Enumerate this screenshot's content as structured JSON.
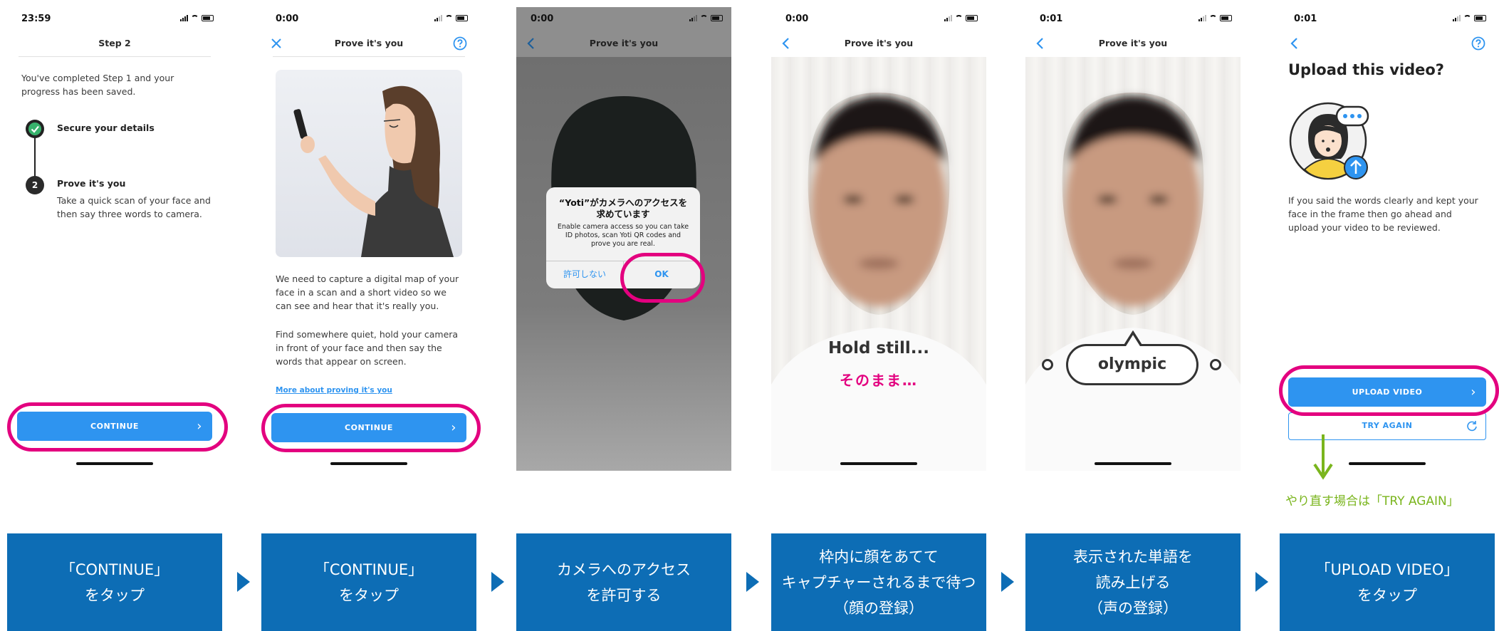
{
  "colors": {
    "accent": "#2e94f0",
    "highlight": "#e3007f",
    "caption_bg": "#0d6db5",
    "green": "#7ab51d",
    "check_green": "#37b26c"
  },
  "screens": [
    {
      "time": "23:59",
      "title": "Step 2",
      "intro": "You've completed Step 1 and your progress has been saved.",
      "step1_label": "Secure your details",
      "step2_number": "2",
      "step2_label": "Prove it's you",
      "step2_desc": "Take a quick scan of your face and then say three words to camera.",
      "button": "CONTINUE"
    },
    {
      "time": "0:00",
      "title": "Prove it's you",
      "para1": "We need to capture a digital map of your face in a scan and a short video so we can see and hear that it's really you.",
      "para2": "Find somewhere quiet, hold your camera in front of your face and then say the words that appear on screen.",
      "link": "More about proving it's you",
      "button": "CONTINUE"
    },
    {
      "time": "0:00",
      "title": "Prove it's you",
      "dialog_title": "“Yoti”がカメラへのアクセスを求めています",
      "dialog_message": "Enable camera access so you can take ID photos, scan Yoti QR codes and prove you are real.",
      "deny": "許可しない",
      "ok": "OK"
    },
    {
      "time": "0:00",
      "title": "Prove it's you",
      "hold_text": "Hold still...",
      "hold_jp": "そのまま…"
    },
    {
      "time": "0:01",
      "title": "Prove it's you",
      "word": "olympic"
    },
    {
      "time": "0:01",
      "heading": "Upload this video?",
      "desc": "If you said the words clearly and kept your face in the frame then go ahead and upload your video to be reviewed.",
      "upload_button": "UPLOAD VIDEO",
      "retry_button": "TRY AGAIN",
      "retry_note": "やり直す場合は「TRY AGAIN」"
    }
  ],
  "captions": [
    [
      "「CONTINUE」",
      "をタップ"
    ],
    [
      "「CONTINUE」",
      "をタップ"
    ],
    [
      "カメラへのアクセス",
      "を許可する"
    ],
    [
      "枠内に顔をあてて",
      "キャプチャーされるまで待つ",
      "（顔の登録）"
    ],
    [
      "表示された単語を",
      "読み上げる",
      "（声の登録）"
    ],
    [
      "「UPLOAD VIDEO」",
      "をタップ"
    ]
  ]
}
